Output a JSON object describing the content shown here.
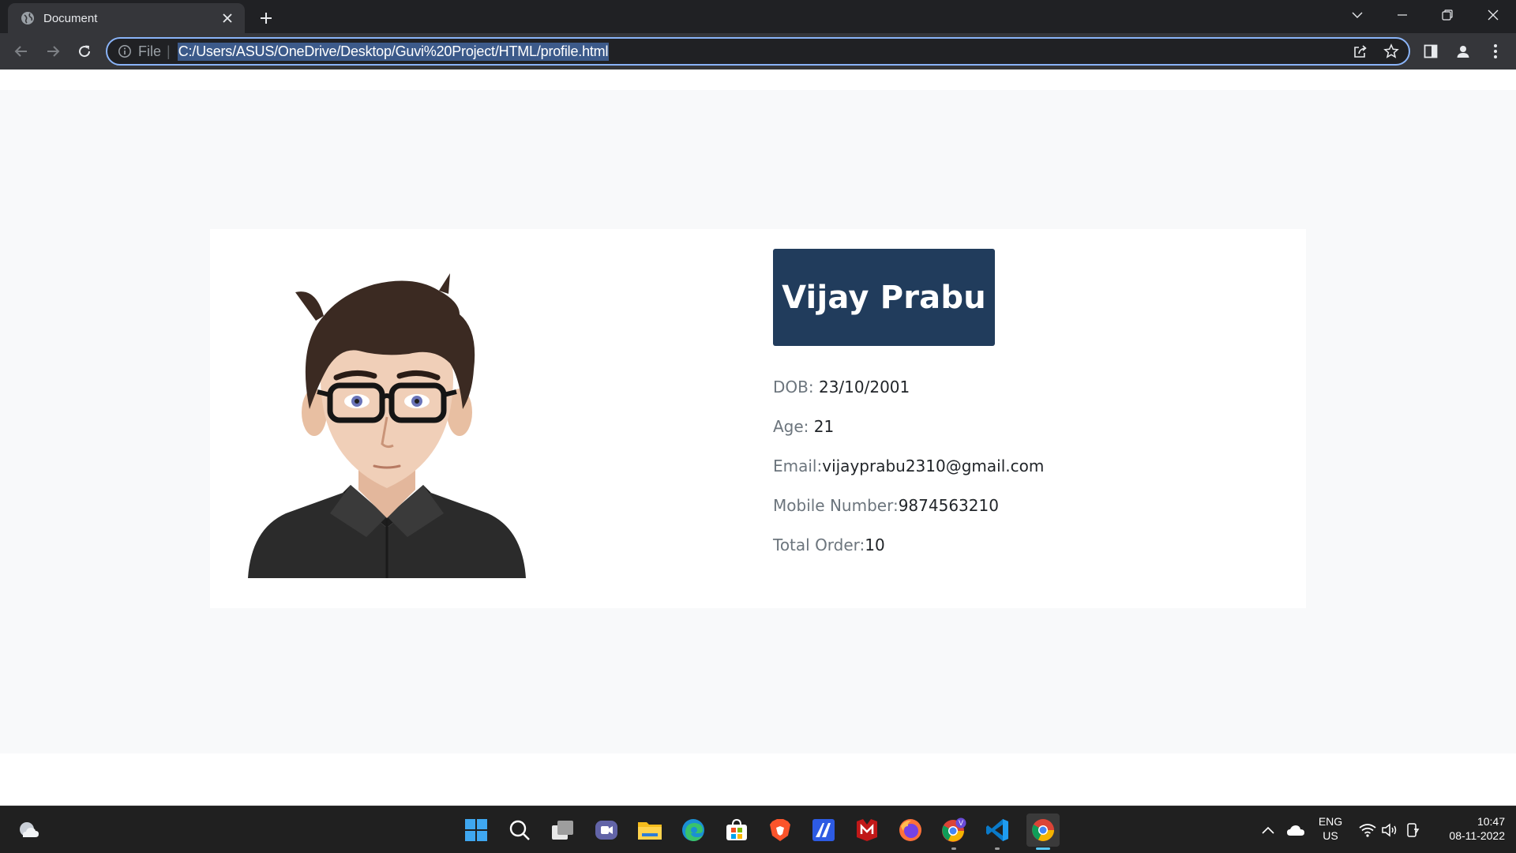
{
  "browser": {
    "tab": {
      "title": "Document"
    },
    "address": {
      "scheme_label": "File",
      "url": "C:/Users/ASUS/OneDrive/Desktop/Guvi%20Project/HTML/profile.html"
    }
  },
  "profile": {
    "name": "Vijay Prabu",
    "fields": [
      {
        "label": "DOB: ",
        "value": "23/10/2001"
      },
      {
        "label": "Age: ",
        "value": "21"
      },
      {
        "label": "Email:",
        "value": "vijayprabu2310@gmail.com"
      },
      {
        "label": "Mobile Number:",
        "value": "9874563210"
      },
      {
        "label": "Total Order:",
        "value": "10"
      }
    ]
  },
  "taskbar": {
    "language": {
      "line1": "ENG",
      "line2": "US"
    },
    "clock": {
      "time": "10:47",
      "date": "08-11-2022"
    },
    "apps": [
      "start-icon",
      "search-icon",
      "task-view-icon",
      "teams-chat-icon",
      "file-explorer-icon",
      "edge-icon",
      "store-icon",
      "brave-icon",
      "app-icon",
      "mcafee-icon",
      "firefox-icon",
      "chrome-profile-icon",
      "vscode-icon",
      "chrome-icon"
    ]
  },
  "colors": {
    "name_box": "#213c5c",
    "page_bg": "#f8f9fa",
    "focus_ring": "#8ab4f8"
  }
}
